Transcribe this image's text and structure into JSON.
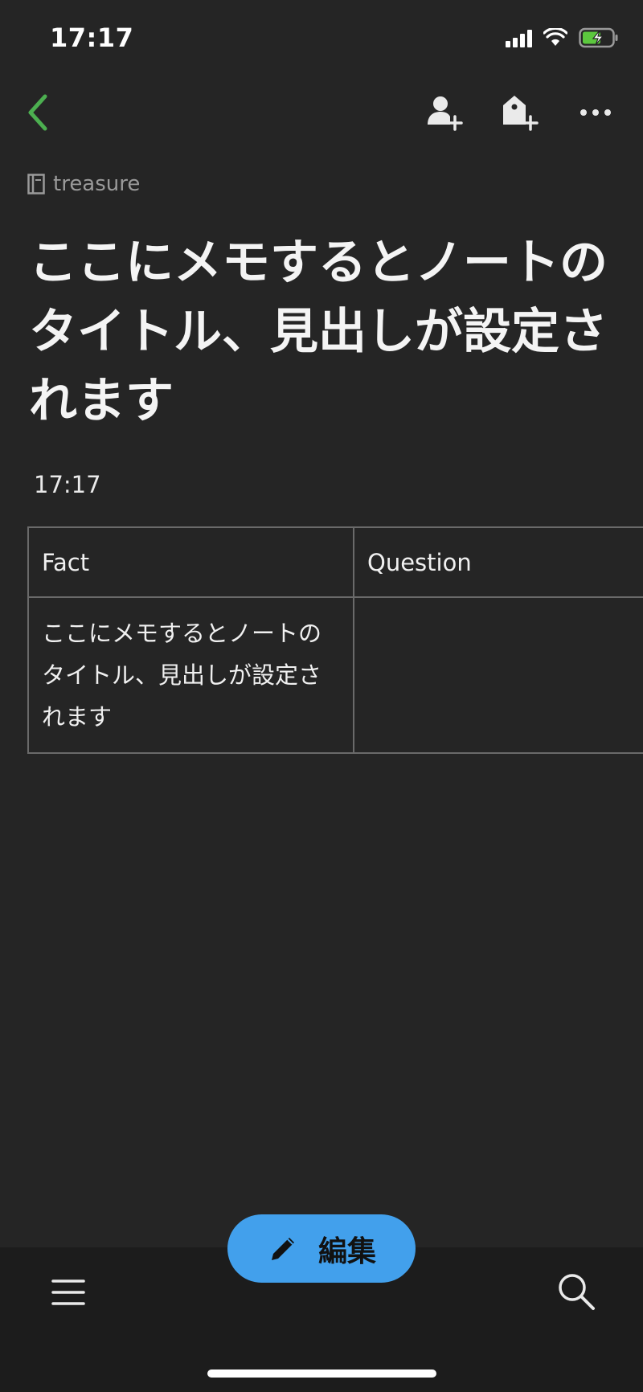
{
  "status": {
    "time": "17:17"
  },
  "nav": {
    "back_icon": "chevron-left-icon",
    "accent": "#4caf50",
    "actions": [
      "add-person-icon",
      "add-tag-icon",
      "more-icon"
    ]
  },
  "note": {
    "notebook": "treasure",
    "title": "ここにメモするとノートのタイトル、見出しが設定されます",
    "time": "17:17",
    "table": {
      "headers": [
        "Fact",
        "Question"
      ],
      "rows": [
        [
          "ここにメモするとノートのタイトル、見出しが設定されます",
          ""
        ]
      ]
    }
  },
  "fab": {
    "label": "編集",
    "color": "#42a0ec"
  },
  "bottom": {
    "menu_icon": "hamburger-menu-icon",
    "search_icon": "search-icon"
  }
}
